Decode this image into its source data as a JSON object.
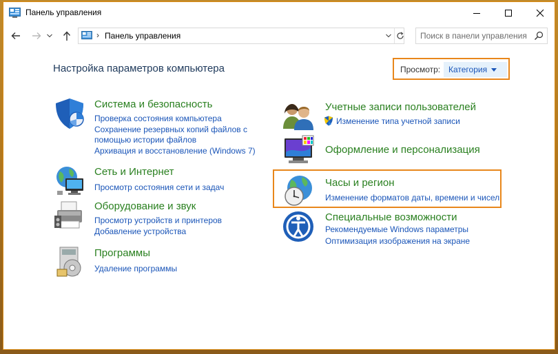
{
  "window": {
    "title": "Панель управления"
  },
  "nav": {
    "address_text": "Панель управления",
    "address_separator": "›",
    "search_placeholder": "Поиск в панели управления"
  },
  "main": {
    "heading": "Настройка параметров компьютера",
    "view_by": {
      "label": "Просмотр:",
      "value": "Категория"
    }
  },
  "categories": {
    "system": {
      "title": "Система и безопасность",
      "links": [
        "Проверка состояния компьютера",
        "Сохранение резервных копий файлов с",
        "помощью истории файлов",
        "Архивация и восстановление (Windows 7)"
      ]
    },
    "network": {
      "title": "Сеть и Интернет",
      "links": [
        "Просмотр состояния сети и задач"
      ]
    },
    "hardware": {
      "title": "Оборудование и звук",
      "links": [
        "Просмотр устройств и принтеров",
        "Добавление устройства"
      ]
    },
    "programs": {
      "title": "Программы",
      "links": [
        "Удаление программы"
      ]
    },
    "accounts": {
      "title": "Учетные записи пользователей",
      "links": [
        "Изменение типа учетной записи"
      ]
    },
    "appearance": {
      "title": "Оформление и персонализация",
      "links": []
    },
    "clock": {
      "title": "Часы и регион",
      "links": [
        "Изменение форматов даты, времени и чисел"
      ]
    },
    "ease": {
      "title": "Специальные возможности",
      "links": [
        "Рекомендуемые Windows параметры",
        "Оптимизация изображения на экране"
      ]
    }
  },
  "colors": {
    "category_title": "#2a8020",
    "link": "#1a55b8",
    "heading": "#1e395b",
    "highlight_border": "#e8861a"
  },
  "icons": [
    "control-panel-icon",
    "back-arrow-icon",
    "forward-arrow-icon",
    "up-arrow-icon",
    "refresh-icon",
    "search-icon",
    "shield-icon",
    "network-globe-icon",
    "printer-icon",
    "programs-disc-icon",
    "users-icon",
    "uac-shield-icon",
    "monitor-palette-icon",
    "clock-globe-icon",
    "ease-of-access-icon"
  ]
}
